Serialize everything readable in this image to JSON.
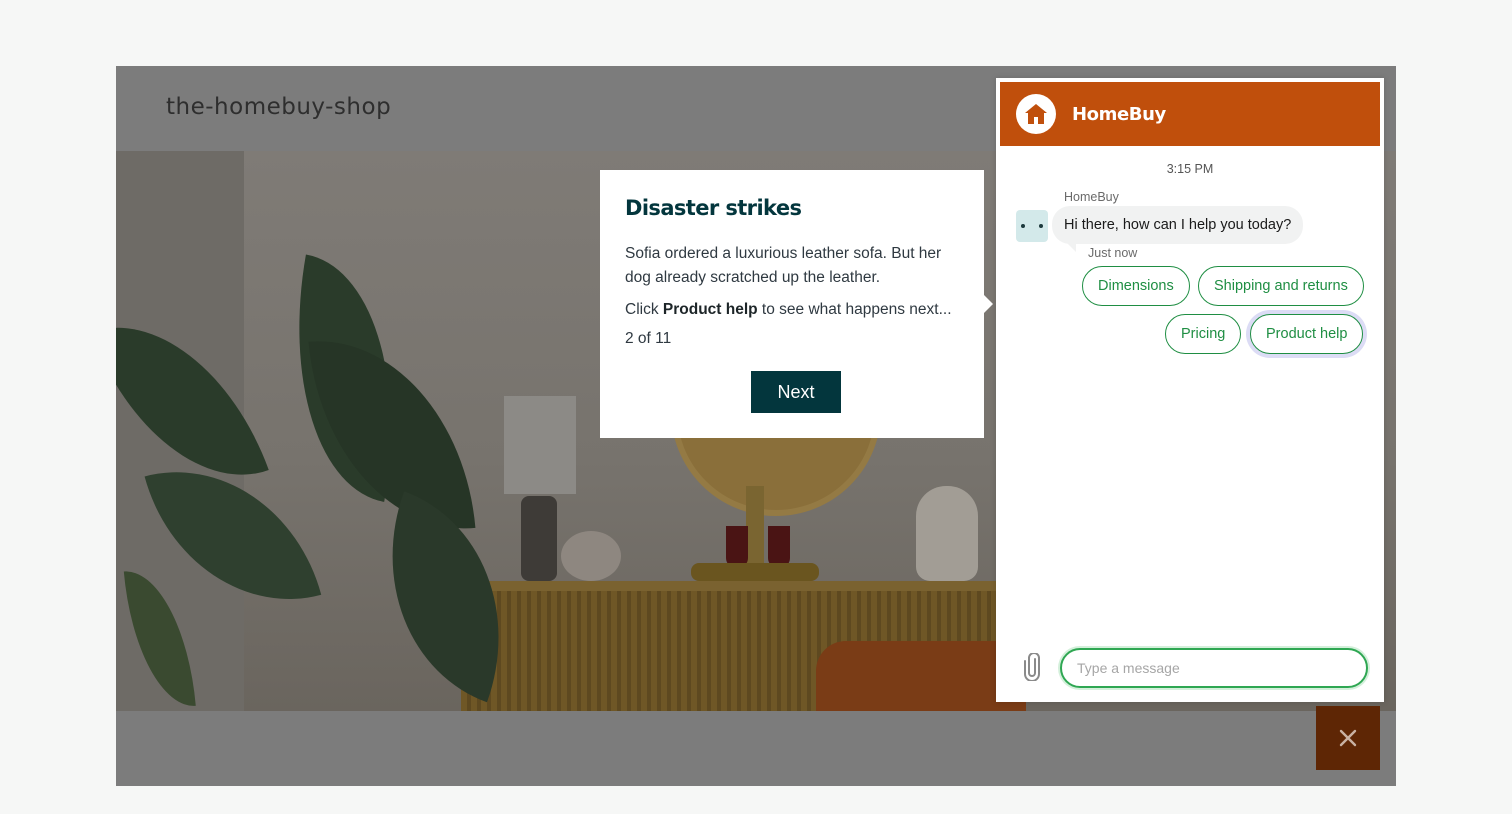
{
  "site": {
    "title": "the-homebuy-shop"
  },
  "tour": {
    "title": "Disaster strikes",
    "paragraph1": "Sofia ordered a luxurious leather sofa. But her dog already scratched up the leather.",
    "paragraph2_prefix": "Click ",
    "paragraph2_bold": "Product help",
    "paragraph2_suffix": " to see what happens next...",
    "step": "2 of 11",
    "next_label": "Next"
  },
  "chat": {
    "brand": "HomeBuy",
    "brand_color": "#c04f0c",
    "logo_icon": "house-icon",
    "timestamp": "3:15 PM",
    "sender": "HomeBuy",
    "message": "Hi there, how can I help you today?",
    "message_time": "Just now",
    "quick_replies": [
      "Dimensions",
      "Shipping and returns",
      "Pricing",
      "Product help"
    ],
    "focused_reply": "Product help",
    "input_placeholder": "Type a message",
    "attach_icon": "paperclip-icon",
    "accent_color": "#1f8e43"
  },
  "launcher": {
    "icon": "close-icon",
    "color": "#5e2605"
  }
}
